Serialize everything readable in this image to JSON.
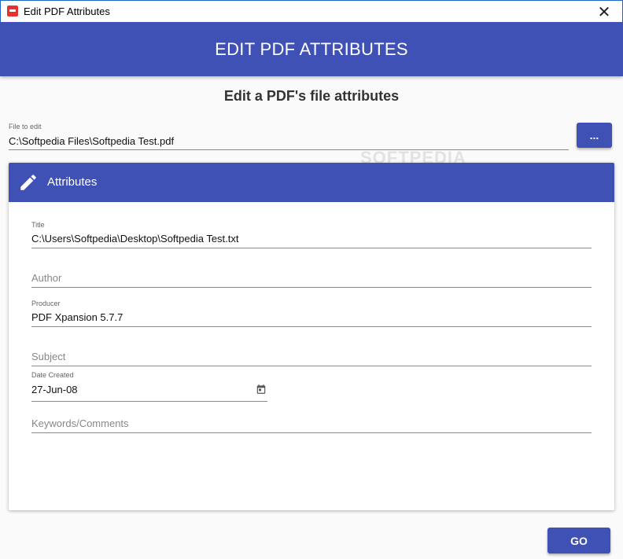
{
  "window": {
    "title": "Edit PDF Attributes",
    "close_glyph": "✕"
  },
  "banner": {
    "title": "EDIT PDF ATTRIBUTES"
  },
  "subtitle": "Edit a PDF's file attributes",
  "file": {
    "label": "File to edit",
    "value": "C:\\Softpedia Files\\Softpedia Test.pdf",
    "browse_label": "..."
  },
  "watermark": "SOFTPEDIA",
  "attributes": {
    "header": "Attributes",
    "title": {
      "label": "Title",
      "value": "C:\\Users\\Softpedia\\Desktop\\Softpedia Test.txt"
    },
    "author": {
      "placeholder": "Author"
    },
    "producer": {
      "label": "Producer",
      "value": "PDF Xpansion 5.7.7"
    },
    "subject": {
      "placeholder": "Subject"
    },
    "date_created": {
      "label": "Date Created",
      "value": "27-Jun-08"
    },
    "keywords": {
      "placeholder": "Keywords/Comments"
    }
  },
  "go_label": "GO",
  "colors": {
    "accent": "#3f51b5",
    "titlebar_border": "#1f66c9",
    "app_icon": "#e5322d"
  }
}
